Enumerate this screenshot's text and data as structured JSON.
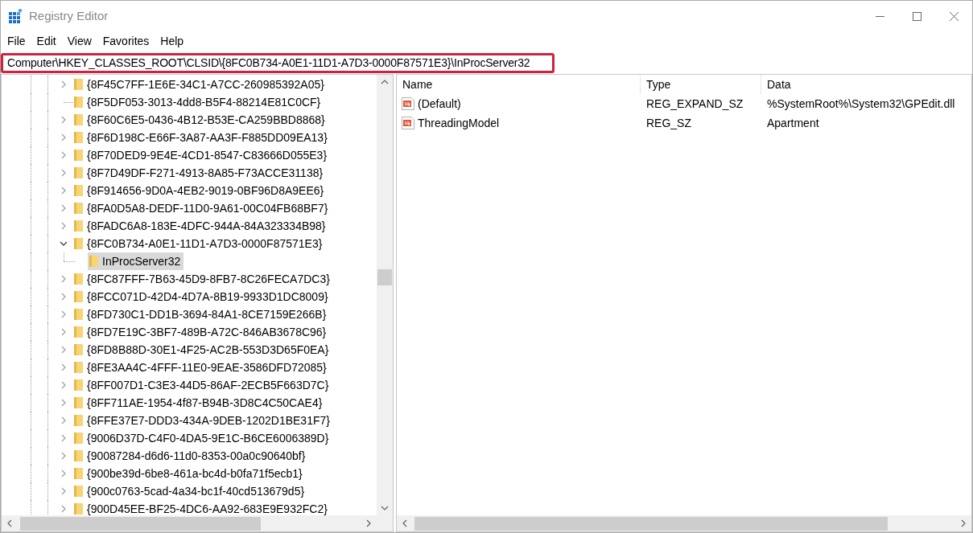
{
  "window": {
    "title": "Registry Editor"
  },
  "menu": [
    "File",
    "Edit",
    "View",
    "Favorites",
    "Help"
  ],
  "address": "Computer\\HKEY_CLASSES_ROOT\\CLSID\\{8FC0B734-A0E1-11D1-A7D3-0000F87571E3}\\InProcServer32",
  "tree": {
    "items": [
      {
        "label": "{8F45C7FF-1E6E-34C1-A7CC-260985392A05}",
        "expandable": true,
        "expanded": false,
        "selected": false
      },
      {
        "label": "{8F5DF053-3013-4dd8-B5F4-88214E81C0CF}",
        "expandable": false,
        "selected": false
      },
      {
        "label": "{8F60C6E5-0436-4B12-B53E-CA259BBD8868}",
        "expandable": true,
        "expanded": false,
        "selected": false
      },
      {
        "label": "{8F6D198C-E66F-3A87-AA3F-F885DD09EA13}",
        "expandable": true,
        "expanded": false,
        "selected": false
      },
      {
        "label": "{8F70DED9-9E4E-4CD1-8547-C83666D055E3}",
        "expandable": true,
        "expanded": false,
        "selected": false
      },
      {
        "label": "{8F7D49DF-F271-4913-8A85-F73ACCE31138}",
        "expandable": true,
        "expanded": false,
        "selected": false
      },
      {
        "label": "{8F914656-9D0A-4EB2-9019-0BF96D8A9EE6}",
        "expandable": true,
        "expanded": false,
        "selected": false
      },
      {
        "label": "{8FA0D5A8-DEDF-11D0-9A61-00C04FB68BF7}",
        "expandable": true,
        "expanded": false,
        "selected": false
      },
      {
        "label": "{8FADC6A8-183E-4DFC-944A-84A323334B98}",
        "expandable": true,
        "expanded": false,
        "selected": false
      },
      {
        "label": "{8FC0B734-A0E1-11D1-A7D3-0000F87571E3}",
        "expandable": true,
        "expanded": true,
        "selected": false,
        "children": [
          {
            "label": "InProcServer32",
            "expandable": false,
            "selected": true
          }
        ]
      },
      {
        "label": "{8FC87FFF-7B63-45D9-8FB7-8C26FECA7DC3}",
        "expandable": true,
        "expanded": false,
        "selected": false
      },
      {
        "label": "{8FCC071D-42D4-4D7A-8B19-9933D1DC8009}",
        "expandable": true,
        "expanded": false,
        "selected": false
      },
      {
        "label": "{8FD730C1-DD1B-3694-84A1-8CE7159E266B}",
        "expandable": true,
        "expanded": false,
        "selected": false
      },
      {
        "label": "{8FD7E19C-3BF7-489B-A72C-846AB3678C96}",
        "expandable": true,
        "expanded": false,
        "selected": false
      },
      {
        "label": "{8FD8B88D-30E1-4F25-AC2B-553D3D65F0EA}",
        "expandable": true,
        "expanded": false,
        "selected": false
      },
      {
        "label": "{8FE3AA4C-4FFF-11E0-9EAE-3586DFD72085}",
        "expandable": true,
        "expanded": false,
        "selected": false
      },
      {
        "label": "{8FF007D1-C3E3-44D5-86AF-2ECB5F663D7C}",
        "expandable": true,
        "expanded": false,
        "selected": false
      },
      {
        "label": "{8FF711AE-1954-4f87-B94B-3D8C4C50CAE4}",
        "expandable": true,
        "expanded": false,
        "selected": false
      },
      {
        "label": "{8FFE37E7-DDD3-434A-9DEB-1202D1BE31F7}",
        "expandable": true,
        "expanded": false,
        "selected": false
      },
      {
        "label": "{9006D37D-C4F0-4DA5-9E1C-B6CE6006389D}",
        "expandable": true,
        "expanded": false,
        "selected": false
      },
      {
        "label": "{90087284-d6d6-11d0-8353-00a0c90640bf}",
        "expandable": true,
        "expanded": false,
        "selected": false
      },
      {
        "label": "{900be39d-6be8-461a-bc4d-b0fa71f5ecb1}",
        "expandable": true,
        "expanded": false,
        "selected": false
      },
      {
        "label": "{900c0763-5cad-4a34-bc1f-40cd513679d5}",
        "expandable": true,
        "expanded": false,
        "selected": false
      },
      {
        "label": "{900D45EE-BF25-4DC6-AA92-683E9E932FC2}",
        "expandable": true,
        "expanded": false,
        "selected": false
      }
    ]
  },
  "values": {
    "columns": [
      "Name",
      "Type",
      "Data"
    ],
    "rows": [
      {
        "name": "(Default)",
        "type": "REG_EXPAND_SZ",
        "data": "%SystemRoot%\\System32\\GPEdit.dll"
      },
      {
        "name": "ThreadingModel",
        "type": "REG_SZ",
        "data": "Apartment"
      }
    ]
  }
}
